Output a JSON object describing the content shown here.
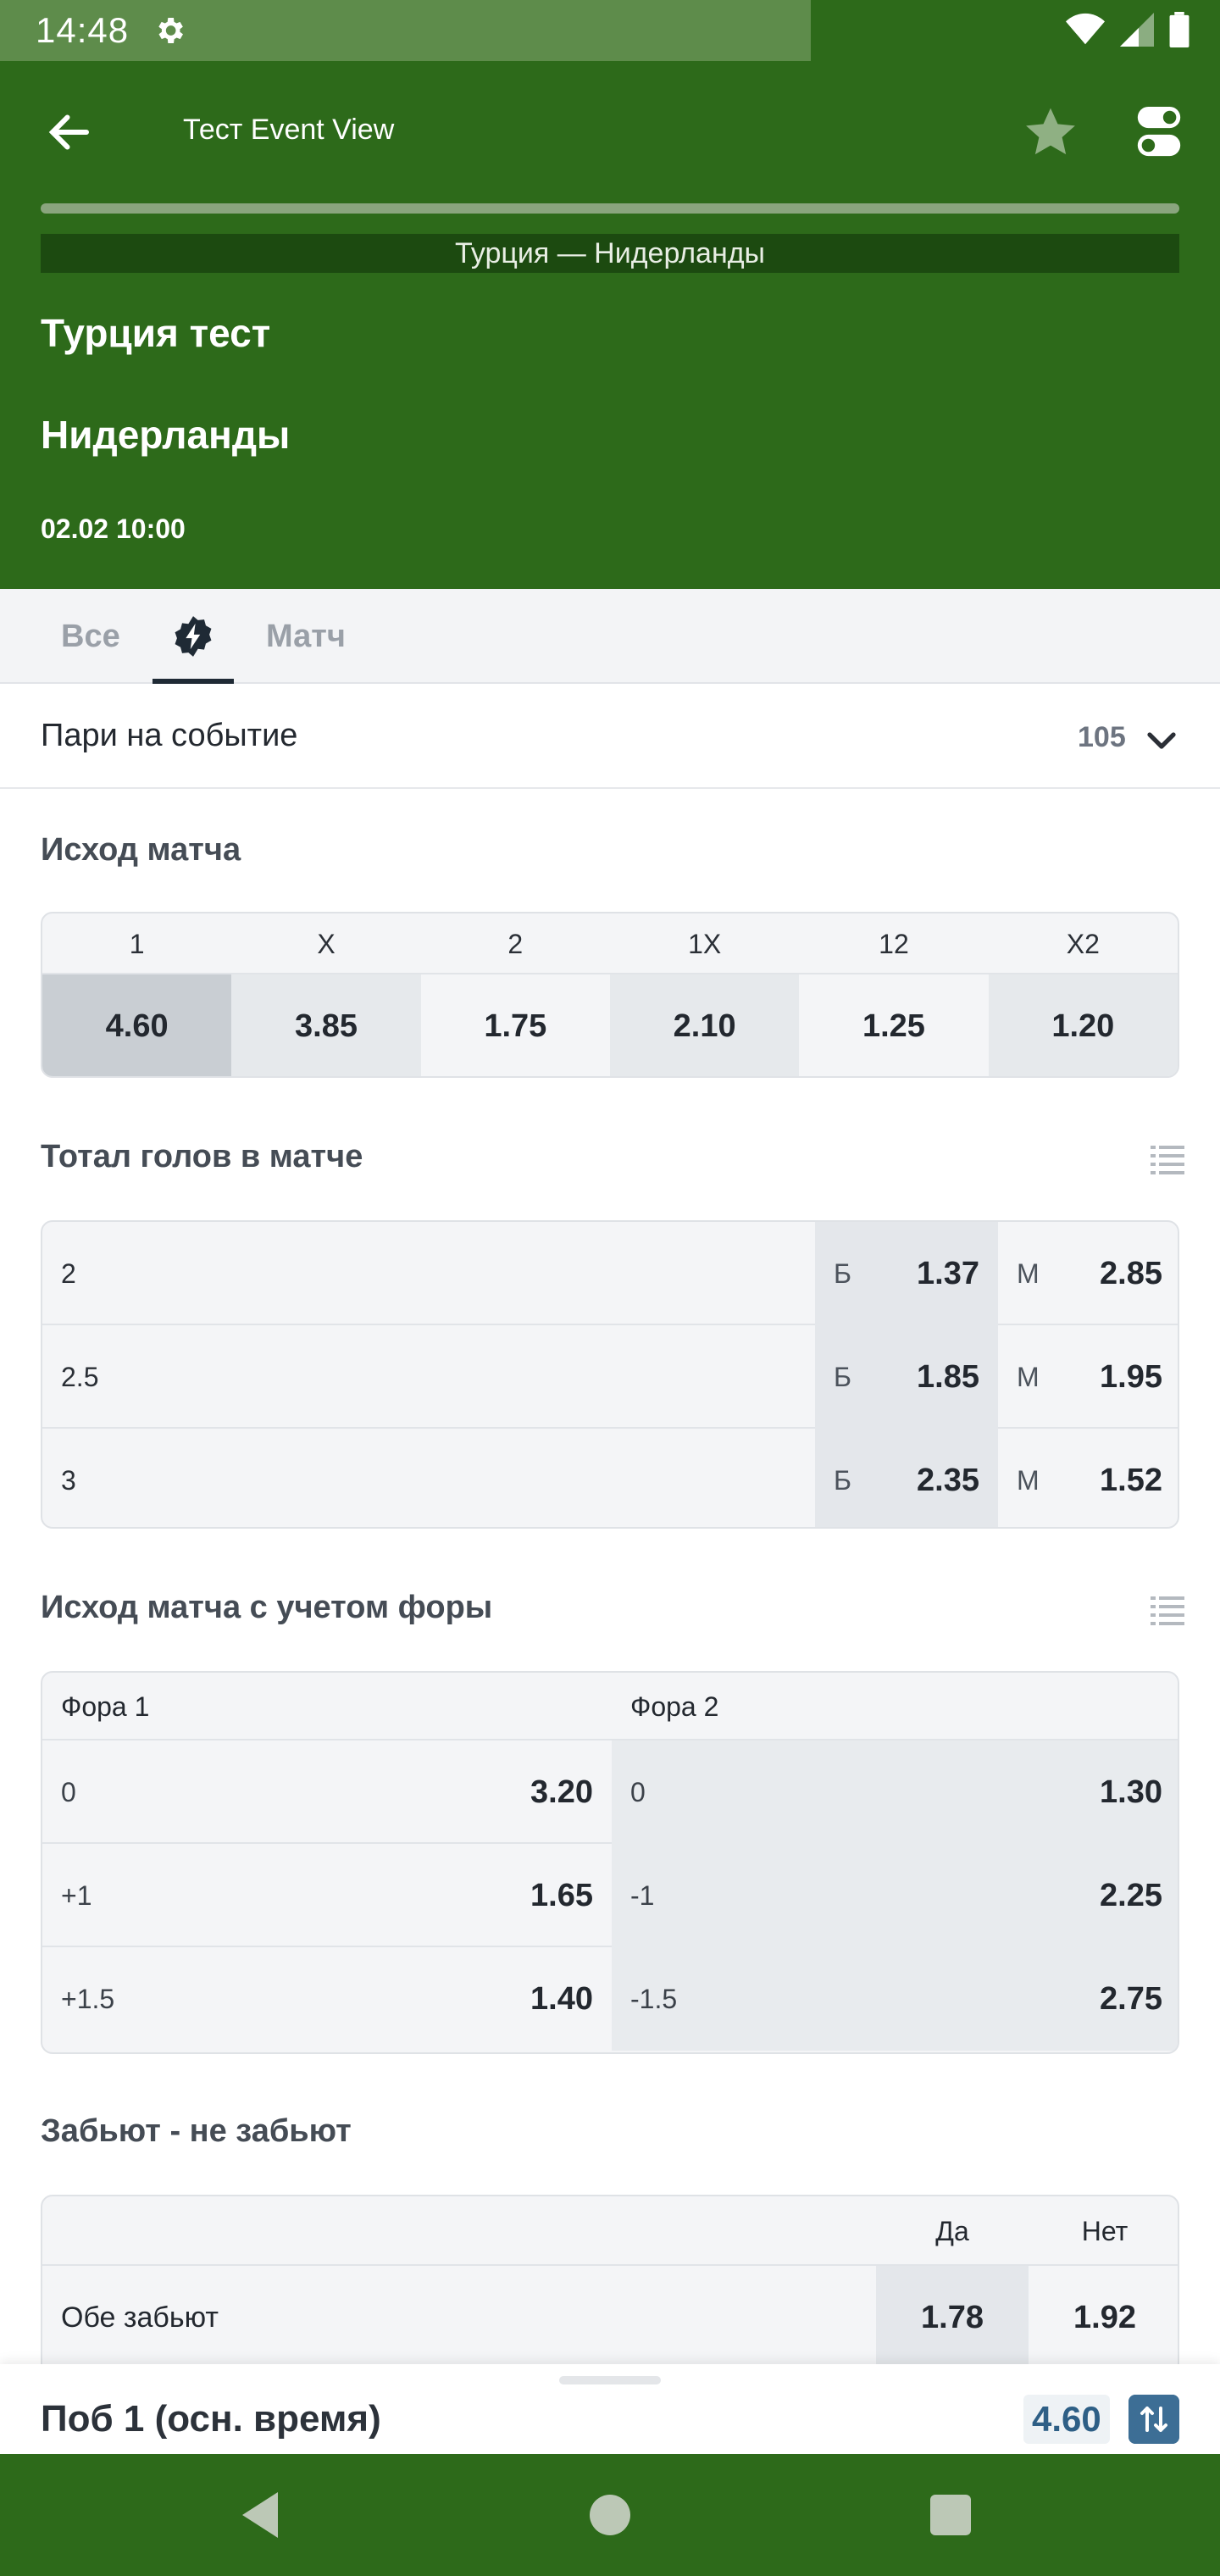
{
  "status_bar": {
    "time": "14:48"
  },
  "header": {
    "title": "Тест Event View",
    "match_name": "Турция — Нидерланды",
    "team1": "Турция тест",
    "team2": "Нидерланды",
    "datetime": "02.02 10:00"
  },
  "tabs": [
    {
      "label": "Все"
    },
    {
      "label": ""
    },
    {
      "label": "Матч"
    }
  ],
  "bets": {
    "label": "Пари на событие",
    "count": "105"
  },
  "sections": {
    "outcome": {
      "title": "Исход матча",
      "headers": [
        "1",
        "X",
        "2",
        "1X",
        "12",
        "X2"
      ],
      "values": [
        "4.60",
        "3.85",
        "1.75",
        "2.10",
        "1.25",
        "1.20"
      ]
    },
    "totals": {
      "title": "Тотал голов в матче",
      "over_letter": "Б",
      "under_letter": "М",
      "rows": [
        {
          "line": "2",
          "over": "1.37",
          "under": "2.85"
        },
        {
          "line": "2.5",
          "over": "1.85",
          "under": "1.95"
        },
        {
          "line": "3",
          "over": "2.35",
          "under": "1.52"
        }
      ]
    },
    "handicap": {
      "title": "Исход матча с учетом форы",
      "head_left": "Фора 1",
      "head_right": "Фора 2",
      "rows": [
        {
          "h1": "0",
          "o1": "3.20",
          "h2": "0",
          "o2": "1.30"
        },
        {
          "h1": "+1",
          "o1": "1.65",
          "h2": "-1",
          "o2": "2.25"
        },
        {
          "h1": "+1.5",
          "o1": "1.40",
          "h2": "-1.5",
          "o2": "2.75"
        }
      ]
    },
    "both_score": {
      "title": "Забьют - не забьют",
      "yes_label": "Да",
      "no_label": "Нет",
      "row_label": "Обе забьют",
      "yes": "1.78",
      "no": "1.92"
    }
  },
  "bet_slip": {
    "title": "Поб 1 (осн. время)",
    "odd": "4.60"
  },
  "colors": {
    "header_green": "#2d6a1a",
    "selected_cell": "#c9ced3",
    "slip_accent": "#3d6e95"
  }
}
